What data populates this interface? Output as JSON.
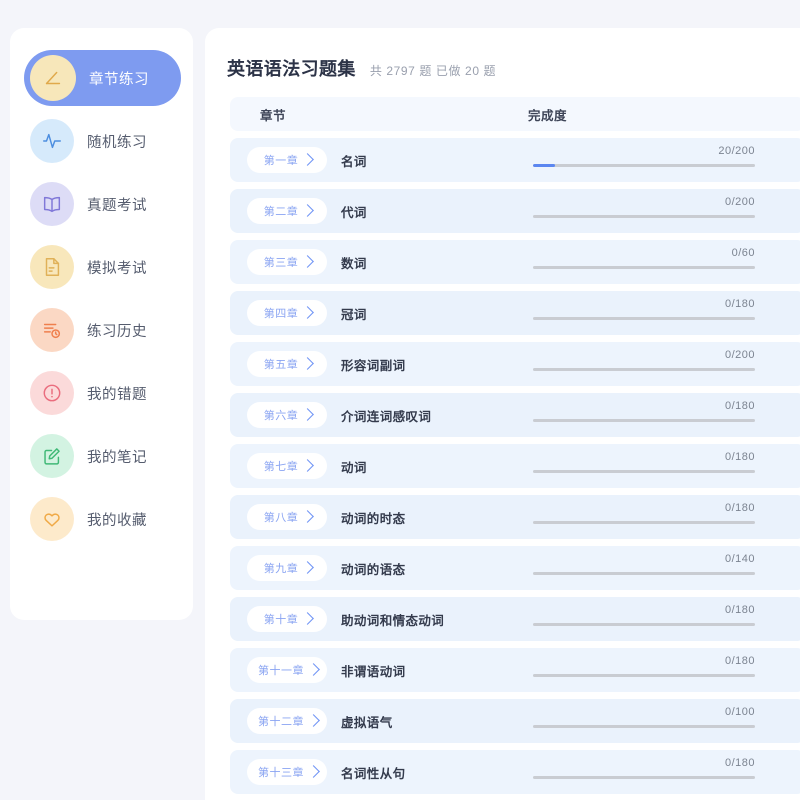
{
  "theme": {
    "page_bg": "#f4f5fa",
    "panel_bg": "#ffffff",
    "accent": "#7e9bf0",
    "progress_fill": "#5b86f0",
    "progress_track": "#c9ccd2",
    "row_bg": "#eaf2fc",
    "row_bg_alt": "#edf4fd",
    "header_row_bg": "#f4f8fe",
    "pill_text": "#8aa4f2",
    "title_text": "#2c3347",
    "subtitle_text": "#9aa0ae"
  },
  "sidebar": {
    "items": [
      {
        "label": "章节练习",
        "icon": "angle-ruler-icon",
        "active": true,
        "circle_bg": "#f7e7ba",
        "icon_color": "#e0a94b"
      },
      {
        "label": "随机练习",
        "icon": "pulse-icon",
        "active": false,
        "circle_bg": "#d6eafb",
        "icon_color": "#4c8ee0"
      },
      {
        "label": "真题考试",
        "icon": "book-icon",
        "active": false,
        "circle_bg": "#dddcf6",
        "icon_color": "#8078d8"
      },
      {
        "label": "模拟考试",
        "icon": "exam-paper-icon",
        "active": false,
        "circle_bg": "#f8e7bb",
        "icon_color": "#e0b158"
      },
      {
        "label": "练习历史",
        "icon": "history-icon",
        "active": false,
        "circle_bg": "#fbd8c4",
        "icon_color": "#ef7f4d"
      },
      {
        "label": "我的错题",
        "icon": "alert-circle-icon",
        "active": false,
        "circle_bg": "#fbdada",
        "icon_color": "#ea6d7e"
      },
      {
        "label": "我的笔记",
        "icon": "note-edit-icon",
        "active": false,
        "circle_bg": "#d3f3e2",
        "icon_color": "#40b977"
      },
      {
        "label": "我的收藏",
        "icon": "heart-icon",
        "active": false,
        "circle_bg": "#fdeacb",
        "icon_color": "#f0a945"
      }
    ]
  },
  "header": {
    "title": "英语语法习题集",
    "subtitle": "共 2797 题 已做 20 题",
    "total_questions": 2797,
    "done_questions": 20
  },
  "table": {
    "columns": {
      "chapter": "章节",
      "progress": "完成度"
    },
    "rows": [
      {
        "chapter": "第一章",
        "title": "名词",
        "done": 20,
        "total": 200,
        "label": "20/200",
        "percent": 10
      },
      {
        "chapter": "第二章",
        "title": "代词",
        "done": 0,
        "total": 200,
        "label": "0/200",
        "percent": 0
      },
      {
        "chapter": "第三章",
        "title": "数词",
        "done": 0,
        "total": 60,
        "label": "0/60",
        "percent": 0
      },
      {
        "chapter": "第四章",
        "title": "冠词",
        "done": 0,
        "total": 180,
        "label": "0/180",
        "percent": 0
      },
      {
        "chapter": "第五章",
        "title": "形容词副词",
        "done": 0,
        "total": 200,
        "label": "0/200",
        "percent": 0
      },
      {
        "chapter": "第六章",
        "title": "介词连词感叹词",
        "done": 0,
        "total": 180,
        "label": "0/180",
        "percent": 0
      },
      {
        "chapter": "第七章",
        "title": "动词",
        "done": 0,
        "total": 180,
        "label": "0/180",
        "percent": 0
      },
      {
        "chapter": "第八章",
        "title": "动词的时态",
        "done": 0,
        "total": 180,
        "label": "0/180",
        "percent": 0
      },
      {
        "chapter": "第九章",
        "title": "动词的语态",
        "done": 0,
        "total": 140,
        "label": "0/140",
        "percent": 0
      },
      {
        "chapter": "第十章",
        "title": "助动词和情态动词",
        "done": 0,
        "total": 180,
        "label": "0/180",
        "percent": 0
      },
      {
        "chapter": "第十一章",
        "title": "非谓语动词",
        "done": 0,
        "total": 180,
        "label": "0/180",
        "percent": 0
      },
      {
        "chapter": "第十二章",
        "title": "虚拟语气",
        "done": 0,
        "total": 100,
        "label": "0/100",
        "percent": 0
      },
      {
        "chapter": "第十三章",
        "title": "名词性从句",
        "done": 0,
        "total": 180,
        "label": "0/180",
        "percent": 0
      }
    ]
  }
}
